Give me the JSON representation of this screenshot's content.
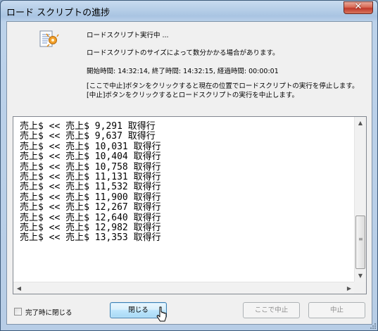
{
  "window": {
    "title": "ロード スクリプトの進捗",
    "close_glyph": "✕"
  },
  "info": {
    "status": "ロードスクリプト実行中 ...",
    "note": "ロードスクリプトのサイズによって数分かかる場合があります。",
    "times": "開始時間: 14:32:14, 終了時間: 14:32:15, 経過時間: 00:00:01",
    "help": "[ここで中止]ボタンをクリックすると現在の位置でロードスクリプトの実行を停止します。[中止]ボタンをクリックするとロードスクリプトの実行を中止します。"
  },
  "log": {
    "lines": [
      "売上$ << 売上$ 9,291 取得行",
      "売上$ << 売上$ 9,637 取得行",
      "売上$ << 売上$ 10,031 取得行",
      "売上$ << 売上$ 10,404 取得行",
      "売上$ << 売上$ 10,758 取得行",
      "売上$ << 売上$ 11,131 取得行",
      "売上$ << 売上$ 11,532 取得行",
      "売上$ << 売上$ 11,900 取得行",
      "売上$ << 売上$ 12,267 取得行",
      "売上$ << 売上$ 12,640 取得行",
      "売上$ << 売上$ 12,982 取得行",
      "売上$ << 売上$ 13,353 取得行"
    ]
  },
  "footer": {
    "checkbox_label": "完了時に閉じる",
    "close_button": "閉じる",
    "stop_here_button": "ここで中止",
    "abort_button": "中止"
  },
  "icons": {
    "script": "script-document-icon",
    "cursor": "mouse-pointer-icon"
  },
  "colors": {
    "accent": "#3c7fb1",
    "title_bar": "#a9c4e2",
    "close_red": "#c0392b"
  }
}
